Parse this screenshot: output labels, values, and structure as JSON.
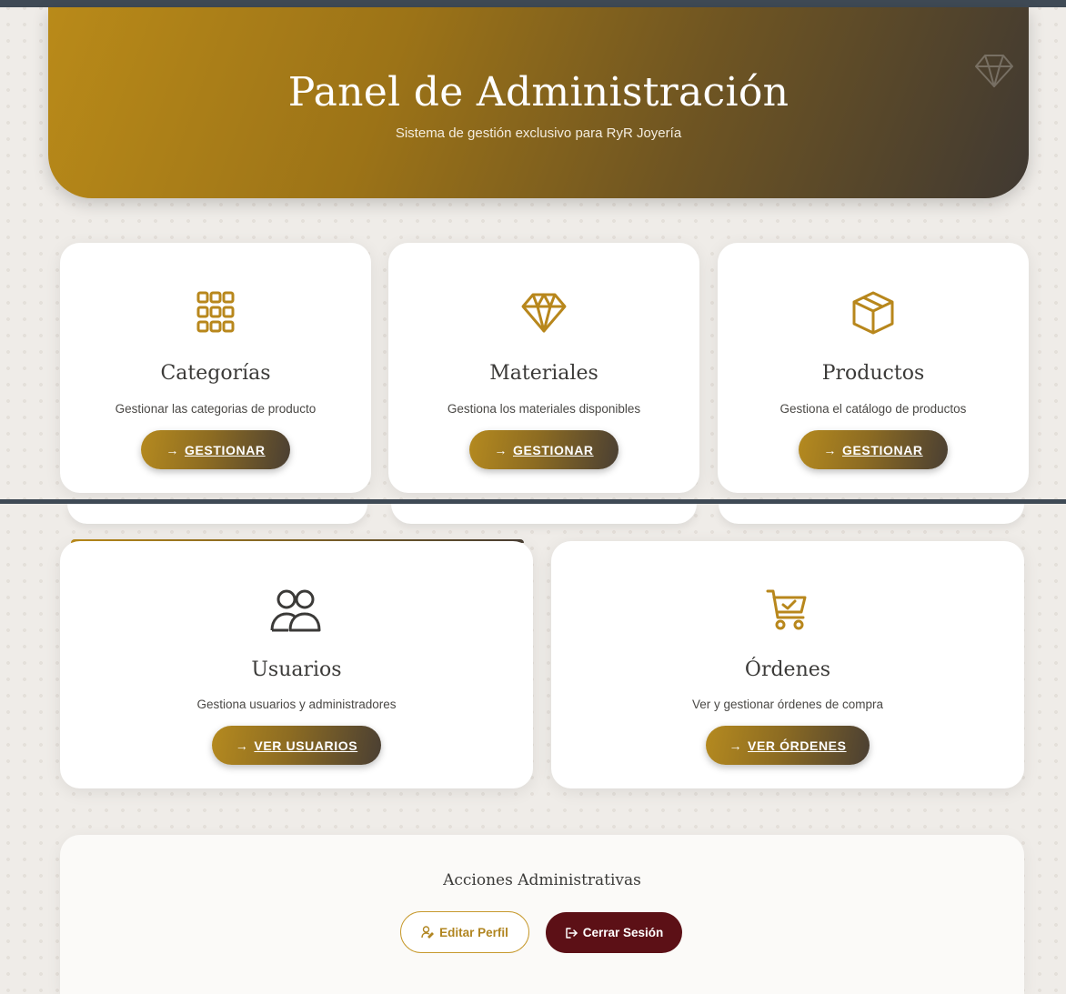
{
  "header": {
    "title": "Panel de Administración",
    "subtitle": "Sistema de gestión exclusivo para RyR Joyería"
  },
  "cards": [
    {
      "title": "Categorías",
      "description": "Gestionar las categorias de producto",
      "button": "GESTIONAR",
      "icon": "grid-icon"
    },
    {
      "title": "Materiales",
      "description": "Gestiona los materiales disponibles",
      "button": "GESTIONAR",
      "icon": "diamond-icon"
    },
    {
      "title": "Productos",
      "description": "Gestiona el catálogo de productos",
      "button": "GESTIONAR",
      "icon": "box-icon"
    },
    {
      "title": "Usuarios",
      "description": "Gestiona usuarios y administradores",
      "button": "VER USUARIOS",
      "icon": "users-icon"
    },
    {
      "title": "Órdenes",
      "description": "Ver y gestionar órdenes de compra",
      "button": "VER ÓRDENES",
      "icon": "cart-icon"
    }
  ],
  "actions": {
    "title": "Acciones Administrativas",
    "edit_profile": "Editar Perfil",
    "logout": "Cerrar Sesión"
  },
  "arrow": "→",
  "colors": {
    "gold": "#b98a19",
    "dark": "#403932",
    "danger": "#5c1016",
    "separator": "#3f4a55"
  }
}
